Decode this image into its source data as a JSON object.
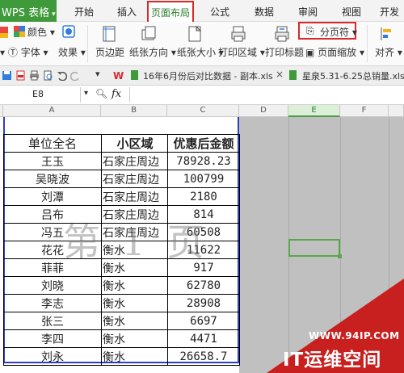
{
  "menu": {
    "app_label": "WPS 表格",
    "tabs": [
      "开始",
      "插入",
      "页面布局",
      "公式",
      "数据",
      "审阅",
      "视图",
      "开发工"
    ],
    "active_tab": "页面布局"
  },
  "ribbon": {
    "color_label": "颜色",
    "font_label": "字体",
    "effect_label": "效果",
    "margin_label": "页边距",
    "orientation_label": "纸张方向",
    "size_label": "纸张大小",
    "print_area_label": "打印区域",
    "print_titles_label": "打印标题",
    "page_scale_label": "页面缩放",
    "page_break_label": "分页符",
    "align_label": "对齐"
  },
  "doc_tabs": [
    {
      "title": "16年6月份后对比数据 - 副本.xls"
    },
    {
      "title": "星泉5.31-6.25总销量.xls *"
    }
  ],
  "formula_bar": {
    "cell_ref": "E8",
    "fx_label": "fx"
  },
  "columns": [
    "A",
    "B",
    "C",
    "D",
    "E",
    "F"
  ],
  "selected_column": "E",
  "table": {
    "headers": [
      "单位全名",
      "小区域",
      "优惠后金额"
    ],
    "rows": [
      [
        "王玉",
        "石家庄周边",
        "78928.23"
      ],
      [
        "吴晓波",
        "石家庄周边",
        "100799"
      ],
      [
        "刘潭",
        "石家庄周边",
        "2180"
      ],
      [
        "吕布",
        "石家庄周边",
        "814"
      ],
      [
        "冯五",
        "石家庄周边",
        "60508"
      ],
      [
        "花花",
        "衡水",
        "11622"
      ],
      [
        "菲菲",
        "衡水",
        "917"
      ],
      [
        "刘晓",
        "衡水",
        "62780"
      ],
      [
        "李志",
        "衡水",
        "28908"
      ],
      [
        "张三",
        "衡水",
        "6697"
      ],
      [
        "李四",
        "衡水",
        "4471"
      ],
      [
        "刘永",
        "衡水",
        "26658.7"
      ]
    ]
  },
  "page_watermark": "第 1 页",
  "site_brand": {
    "url": "WWW.94IP.COM",
    "name": "IT运维空间"
  },
  "colors": {
    "accent_green": "#3e9a3a",
    "highlight_red": "#d9292b",
    "page_border_blue": "#2b3fc4",
    "brand_red": "#c81f1f"
  }
}
